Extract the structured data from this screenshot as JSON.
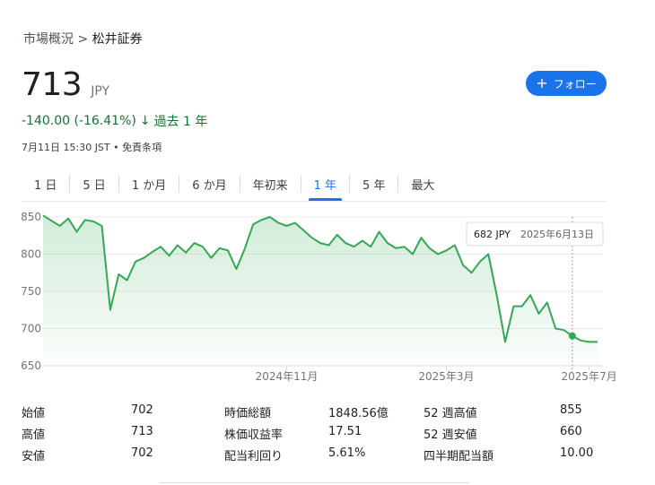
{
  "breadcrumb": {
    "parent": "市場概況",
    "separator": ">",
    "current": "松井証券"
  },
  "quote": {
    "price": "713",
    "currency": "JPY",
    "change": "-140.00 (-16.41%)",
    "change_arrow": "↓",
    "period": "過去 1 年",
    "meta": "7月11日 15:30 JST • 免責条項"
  },
  "follow": {
    "plus": "+",
    "label": "フォロー"
  },
  "tabs": [
    "1 日",
    "5 日",
    "1 か月",
    "6 か月",
    "年初来",
    "1 年",
    "5 年",
    "最大"
  ],
  "active_tab": "1 年",
  "colors": {
    "line": "#34a853",
    "accent": "#1a73e8",
    "negative": "#137333"
  },
  "tooltip": {
    "value": "682 JPY",
    "date": "2025年6月13日"
  },
  "chart_data": {
    "type": "area",
    "y_ticks": [
      "850",
      "800",
      "750",
      "700",
      "650"
    ],
    "x_tick_labels": [
      "2024年11月",
      "2025年3月",
      "2025年7月"
    ],
    "ylim": [
      650,
      855
    ],
    "grid": true,
    "x": [
      "2024-07",
      "2024-07",
      "2024-07",
      "2024-07",
      "2024-07",
      "2024-07",
      "2024-07",
      "2024-08",
      "2024-08",
      "2024-08",
      "2024-08",
      "2024-08",
      "2024-08",
      "2024-08",
      "2024-08",
      "2024-08",
      "2024-09",
      "2024-09",
      "2024-09",
      "2024-09",
      "2024-09",
      "2024-09",
      "2024-09",
      "2024-10",
      "2024-10",
      "2024-10",
      "2024-10",
      "2024-10",
      "2024-10",
      "2024-11",
      "2024-11",
      "2024-11",
      "2024-11",
      "2024-11",
      "2024-12",
      "2024-12",
      "2024-12",
      "2024-12",
      "2024-12",
      "2025-01",
      "2025-01",
      "2025-01",
      "2025-01",
      "2025-01",
      "2025-02",
      "2025-02",
      "2025-02",
      "2025-02",
      "2025-03",
      "2025-03",
      "2025-03",
      "2025-03",
      "2025-04",
      "2025-04",
      "2025-04",
      "2025-04",
      "2025-04",
      "2025-05",
      "2025-05",
      "2025-05",
      "2025-05",
      "2025-06",
      "2025-06",
      "2025-06",
      "2025-06",
      "2025-07",
      "2025-07"
    ],
    "values": [
      852,
      845,
      838,
      848,
      830,
      846,
      844,
      838,
      725,
      773,
      765,
      790,
      795,
      803,
      810,
      798,
      812,
      802,
      815,
      810,
      795,
      808,
      805,
      780,
      807,
      840,
      846,
      850,
      842,
      838,
      842,
      832,
      822,
      815,
      812,
      826,
      815,
      810,
      818,
      810,
      830,
      815,
      808,
      810,
      800,
      822,
      808,
      800,
      805,
      812,
      785,
      775,
      790,
      800,
      745,
      682,
      730,
      730,
      745,
      720,
      735,
      700,
      698,
      690,
      684,
      682,
      682
    ],
    "series_name": ""
  },
  "stats": [
    {
      "label": "始値",
      "value": "702"
    },
    {
      "label": "高値",
      "value": "713"
    },
    {
      "label": "安値",
      "value": "702"
    },
    {
      "label": "時価総額",
      "value": "1848.56億"
    },
    {
      "label": "株価収益率",
      "value": "17.51"
    },
    {
      "label": "配当利回り",
      "value": "5.61%"
    },
    {
      "label": "52 週高値",
      "value": "855"
    },
    {
      "label": "52 週安値",
      "value": "660"
    },
    {
      "label": "四半期配当額",
      "value": "10.00"
    }
  ]
}
